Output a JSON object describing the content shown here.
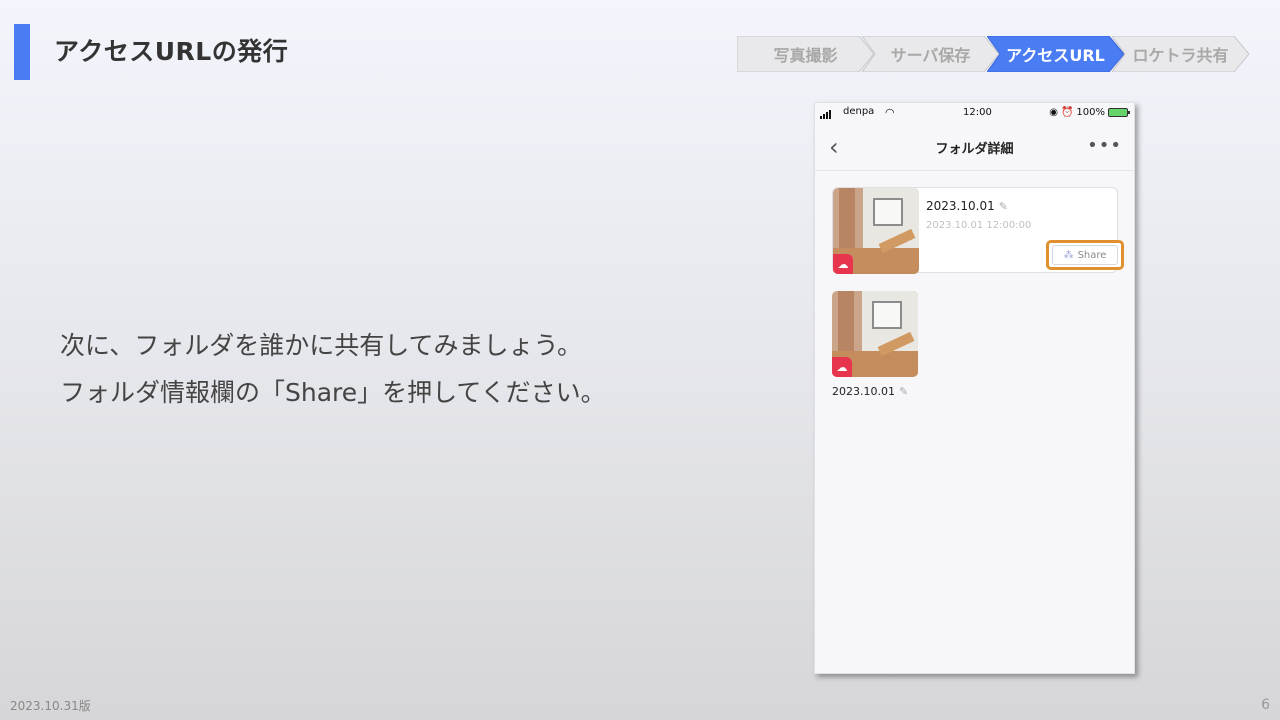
{
  "slide": {
    "title": "アクセスURLの発行",
    "footer_date": "2023.10.31版",
    "page_number": "6"
  },
  "steps": [
    {
      "label": "写真撮影",
      "active": false
    },
    {
      "label": "サーバ保存",
      "active": false
    },
    {
      "label": "アクセスURL",
      "active": true
    },
    {
      "label": "ロケトラ共有",
      "active": false
    }
  ],
  "colors": {
    "accent": "#4a7cf4",
    "highlight": "#e0902e",
    "badge": "#e8354e"
  },
  "instruction": {
    "line1": "次に、フォルダを誰かに共有してみましょう。",
    "line2": "フォルダ情報欄の「Share」を押してください。"
  },
  "phone": {
    "status": {
      "carrier": "denpa",
      "time": "12:00",
      "battery": "100%"
    },
    "nav": {
      "title": "フォルダ詳細",
      "back_icon": "chevron-left-icon",
      "more_icon": "more-dots-icon"
    },
    "card": {
      "title": "2023.10.01",
      "timestamp": "2023.10.01 12:00:00",
      "share_label": "Share"
    },
    "grid": [
      {
        "label": "2023.10.01"
      }
    ]
  }
}
